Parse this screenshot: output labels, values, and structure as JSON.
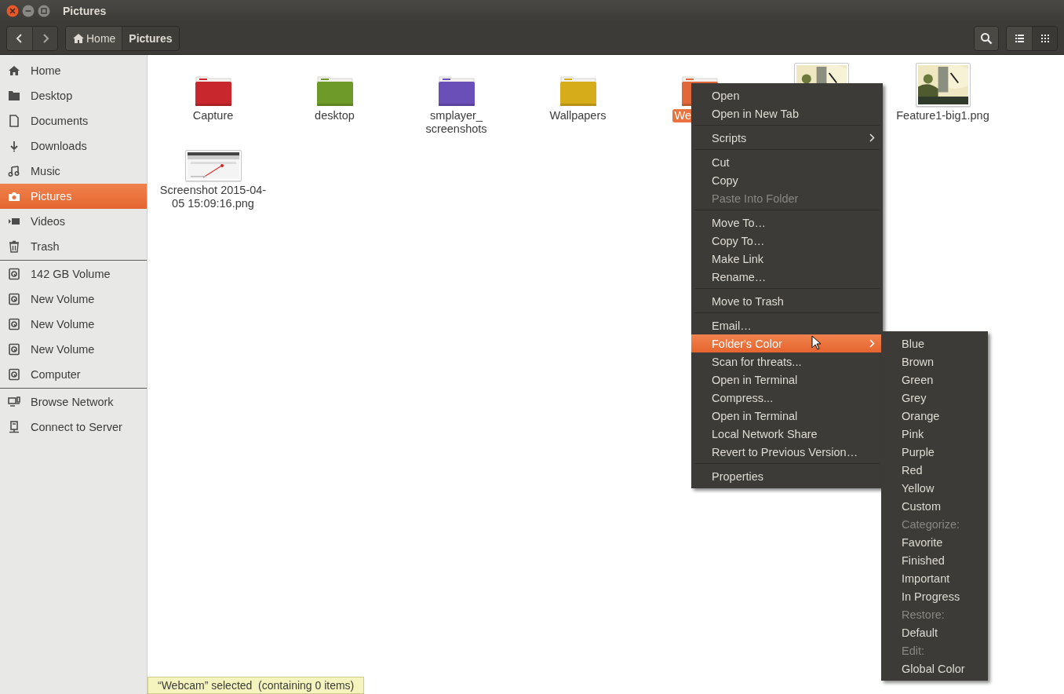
{
  "window": {
    "title": "Pictures"
  },
  "toolbar": {
    "breadcrumbs": [
      {
        "label": "Home",
        "kind": "home",
        "selected": false
      },
      {
        "label": "Pictures",
        "kind": "plain",
        "selected": true
      }
    ],
    "views": [
      {
        "kind": "list",
        "selected": false
      },
      {
        "kind": "grid",
        "selected": true
      }
    ]
  },
  "sidebar": {
    "sections": [
      [
        {
          "label": "Home",
          "kind": "home",
          "selected": false
        },
        {
          "label": "Desktop",
          "kind": "desktop",
          "selected": false
        },
        {
          "label": "Documents",
          "kind": "document",
          "selected": false
        },
        {
          "label": "Downloads",
          "kind": "download",
          "selected": false
        },
        {
          "label": "Music",
          "kind": "music",
          "selected": false
        },
        {
          "label": "Pictures",
          "kind": "camera",
          "selected": true
        },
        {
          "label": "Videos",
          "kind": "video",
          "selected": false
        },
        {
          "label": "Trash",
          "kind": "trash",
          "selected": false
        }
      ],
      [
        {
          "label": "142 GB Volume",
          "kind": "drive",
          "selected": false
        },
        {
          "label": "New Volume",
          "kind": "drive",
          "selected": false
        },
        {
          "label": "New Volume",
          "kind": "drive",
          "selected": false
        },
        {
          "label": "New Volume",
          "kind": "drive",
          "selected": false
        },
        {
          "label": "Computer",
          "kind": "drive",
          "selected": false
        }
      ],
      [
        {
          "label": "Browse Network",
          "kind": "network",
          "selected": false
        },
        {
          "label": "Connect to Server",
          "kind": "server",
          "selected": false
        }
      ]
    ]
  },
  "items": [
    {
      "kind": "folder",
      "name": "Capture",
      "color": "#c8272d",
      "selected": false
    },
    {
      "kind": "folder",
      "name": "desktop",
      "color": "#6e9a2a",
      "selected": false
    },
    {
      "kind": "folder",
      "name": "smplayer_ screenshots",
      "color": "#6a4fb8",
      "selected": false
    },
    {
      "kind": "folder",
      "name": "Wallpapers",
      "color": "#d6ac1a",
      "selected": false
    },
    {
      "kind": "folder",
      "name": "We",
      "color": "#e0683a",
      "selected": true,
      "cut_by_menu": true
    },
    {
      "kind": "picture",
      "selected": false
    },
    {
      "kind": "picture",
      "name": "Feature1-big1.png",
      "selected": false
    },
    {
      "kind": "screenshot",
      "name": "Screenshot 2015-04-05 15:09:16.png",
      "selected": false
    }
  ],
  "status": "“Webcam” selected  (containing 0 items)",
  "context_menu": [
    {
      "kind": "item",
      "label": "Open",
      "disabled": false,
      "selected": false
    },
    {
      "kind": "item",
      "label": "Open in New Tab",
      "disabled": false,
      "selected": false
    },
    {
      "kind": "separator"
    },
    {
      "kind": "submenu",
      "label": "Scripts",
      "disabled": false,
      "selected": false
    },
    {
      "kind": "separator"
    },
    {
      "kind": "item",
      "label": "Cut",
      "disabled": false,
      "selected": false
    },
    {
      "kind": "item",
      "label": "Copy",
      "disabled": false,
      "selected": false
    },
    {
      "kind": "item",
      "label": "Paste Into Folder",
      "disabled": true,
      "selected": false
    },
    {
      "kind": "separator"
    },
    {
      "kind": "item",
      "label": "Move To…",
      "disabled": false,
      "selected": false
    },
    {
      "kind": "item",
      "label": "Copy To…",
      "disabled": false,
      "selected": false
    },
    {
      "kind": "item",
      "label": "Make Link",
      "disabled": false,
      "selected": false
    },
    {
      "kind": "item",
      "label": "Rename…",
      "disabled": false,
      "selected": false
    },
    {
      "kind": "separator"
    },
    {
      "kind": "item",
      "label": "Move to Trash",
      "disabled": false,
      "selected": false
    },
    {
      "kind": "separator"
    },
    {
      "kind": "item",
      "label": "Email…",
      "disabled": false,
      "selected": false
    },
    {
      "kind": "submenu",
      "label": "Folder's Color",
      "disabled": false,
      "selected": true
    },
    {
      "kind": "item",
      "label": "Scan for threats...",
      "disabled": false,
      "selected": false
    },
    {
      "kind": "item",
      "label": "Open in Terminal",
      "disabled": false,
      "selected": false
    },
    {
      "kind": "item",
      "label": "Compress...",
      "disabled": false,
      "selected": false
    },
    {
      "kind": "item",
      "label": "Open in Terminal",
      "disabled": false,
      "selected": false
    },
    {
      "kind": "item",
      "label": "Local Network Share",
      "disabled": false,
      "selected": false
    },
    {
      "kind": "item",
      "label": "Revert to Previous Version…",
      "disabled": false,
      "selected": false
    },
    {
      "kind": "separator"
    },
    {
      "kind": "item",
      "label": "Properties",
      "disabled": false,
      "selected": false
    }
  ],
  "submenu": [
    {
      "label": "Blue",
      "disabled": false
    },
    {
      "label": "Brown",
      "disabled": false
    },
    {
      "label": "Green",
      "disabled": false
    },
    {
      "label": "Grey",
      "disabled": false
    },
    {
      "label": "Orange",
      "disabled": false
    },
    {
      "label": "Pink",
      "disabled": false
    },
    {
      "label": "Purple",
      "disabled": false
    },
    {
      "label": "Red",
      "disabled": false
    },
    {
      "label": "Yellow",
      "disabled": false
    },
    {
      "label": "Custom",
      "disabled": false
    },
    {
      "label": "Categorize:",
      "disabled": true
    },
    {
      "label": "Favorite",
      "disabled": false
    },
    {
      "label": "Finished",
      "disabled": false
    },
    {
      "label": "Important",
      "disabled": false
    },
    {
      "label": "In Progress",
      "disabled": false
    },
    {
      "label": "Restore:",
      "disabled": true
    },
    {
      "label": "Default",
      "disabled": false
    },
    {
      "label": "Edit:",
      "disabled": true
    },
    {
      "label": "Global Color",
      "disabled": false
    }
  ]
}
